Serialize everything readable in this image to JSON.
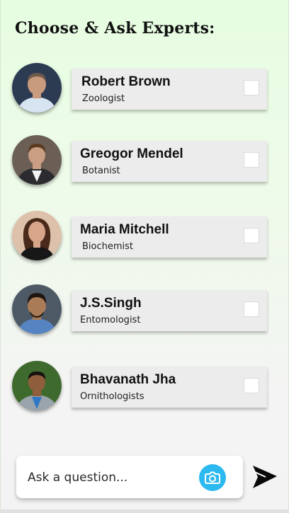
{
  "header": {
    "title": "Choose & Ask Experts:"
  },
  "experts": [
    {
      "name": "Robert Brown",
      "role": "Zoologist",
      "selected": false,
      "bg_color": "#2c3a52",
      "shirt_color": "#d7e5f3",
      "skin_color": "#c89a7e",
      "hair_color": "#6e5a4b"
    },
    {
      "name": "Greogor Mendel",
      "role": "Botanist",
      "selected": false,
      "bg_color": "#6b5e54",
      "shirt_color": "#f4f4f4",
      "skin_color": "#c99e82",
      "hair_color": "#5a3b22"
    },
    {
      "name": "Maria Mitchell",
      "role": "Biochemist",
      "selected": false,
      "bg_color": "#ddc1aa",
      "shirt_color": "#171717",
      "skin_color": "#d7a58a",
      "hair_color": "#4a2a1a"
    },
    {
      "name": "J.S.Singh",
      "role": "Entomologist",
      "selected": false,
      "bg_color": "#4d5a66",
      "shirt_color": "#5684c2",
      "skin_color": "#a97b57",
      "hair_color": "#1f1612"
    },
    {
      "name": "Bhavanath Jha",
      "role": "Ornithologists",
      "selected": false,
      "bg_color": "#3f6a2e",
      "shirt_color": "#2e77c4",
      "skin_color": "#8f5e3d",
      "hair_color": "#171110"
    }
  ],
  "ask": {
    "placeholder": "Ask a question...",
    "camera_icon": "camera-icon",
    "send_icon": "send-arrow-icon",
    "accent_color": "#2bb9f0"
  }
}
